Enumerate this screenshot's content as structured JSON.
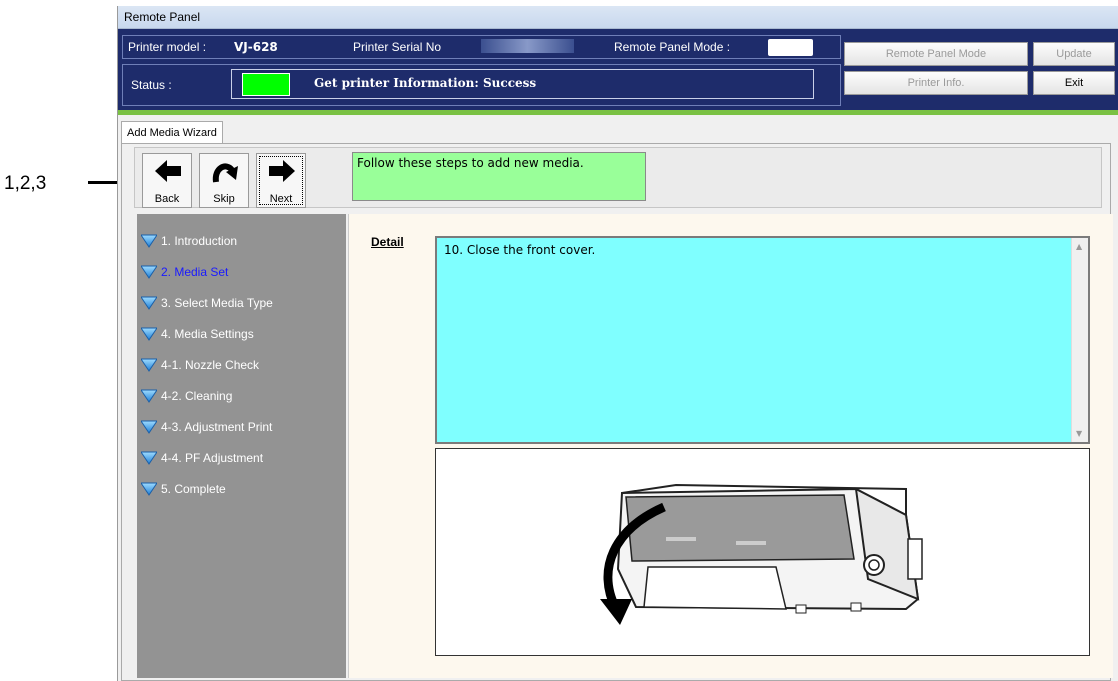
{
  "callout": {
    "label": "1,2,3"
  },
  "window": {
    "title": "Remote Panel"
  },
  "info": {
    "printer_model_label": "Printer model :",
    "printer_model_value": "VJ-628",
    "serial_label": "Printer Serial No",
    "mode_label": "Remote Panel Mode :",
    "status_label": "Status :",
    "status_text": "Get printer Information: Success",
    "status_color": "#00ff00"
  },
  "buttons": {
    "remote_panel_mode": "Remote Panel Mode",
    "update": "Update",
    "printer_info": "Printer Info.",
    "exit": "Exit"
  },
  "tab": {
    "label": "Add Media Wizard"
  },
  "toolbar": {
    "back": "Back",
    "skip": "Skip",
    "next": "Next",
    "message": "Follow these steps to add new media."
  },
  "steps": [
    {
      "label": "1. Introduction",
      "active": false
    },
    {
      "label": "2. Media Set",
      "active": true
    },
    {
      "label": "3. Select Media Type",
      "active": false
    },
    {
      "label": "4. Media Settings",
      "active": false
    },
    {
      "label": "4-1. Nozzle Check",
      "active": false
    },
    {
      "label": "4-2. Cleaning",
      "active": false
    },
    {
      "label": "4-3. Adjustment Print",
      "active": false
    },
    {
      "label": "4-4. PF Adjustment",
      "active": false
    },
    {
      "label": "5. Complete",
      "active": false
    }
  ],
  "detail": {
    "label": "Detail",
    "text": "10. Close the front cover."
  },
  "icons": {
    "back": "arrow-left-icon",
    "skip": "curved-arrow-icon",
    "next": "arrow-right-icon",
    "step": "triangle-down-icon"
  }
}
